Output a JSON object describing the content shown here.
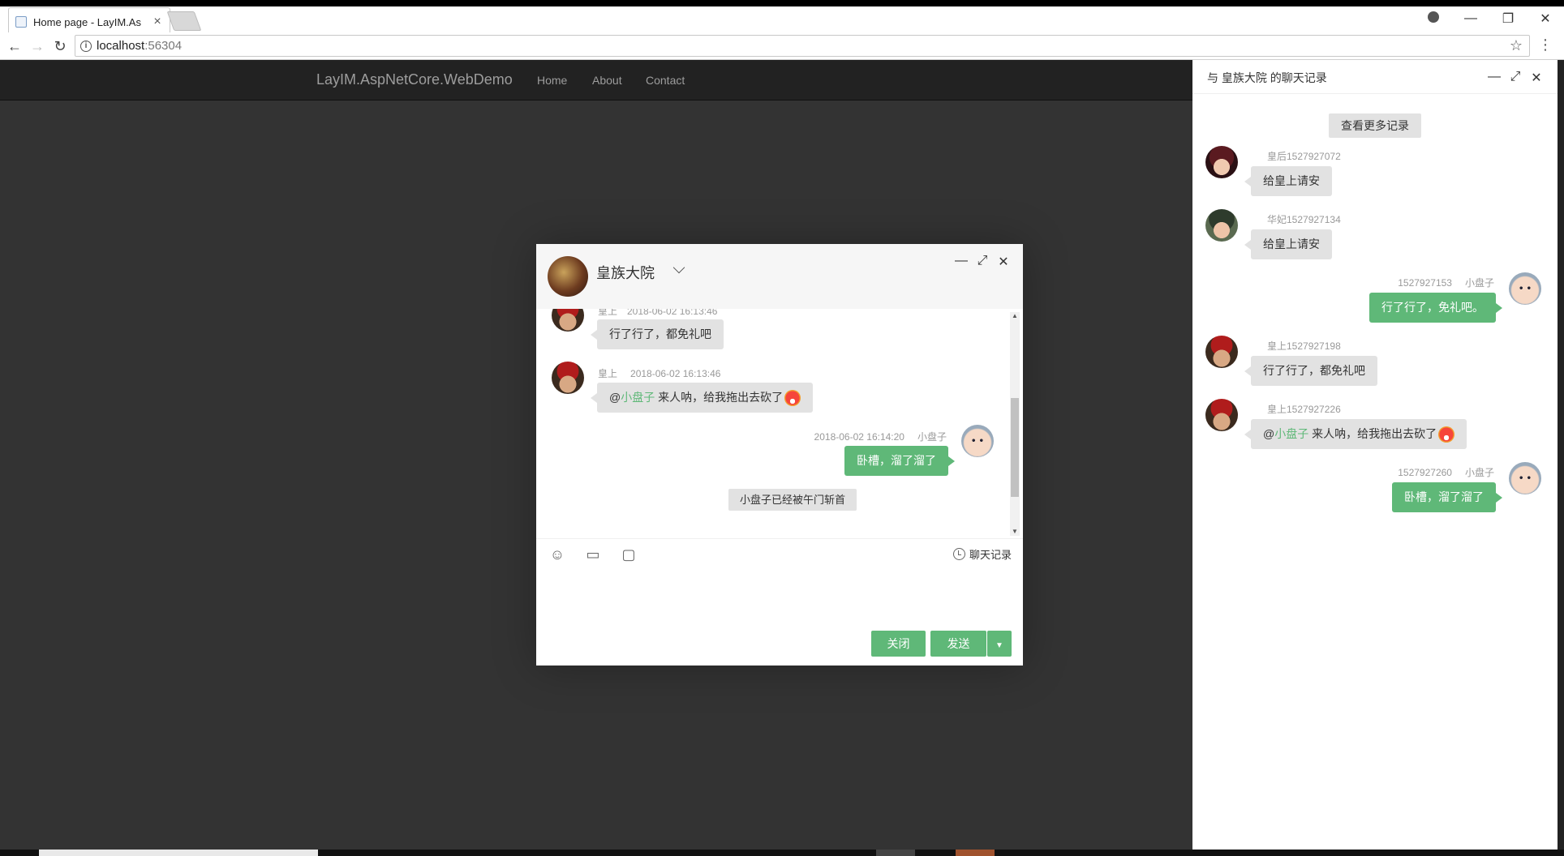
{
  "browser": {
    "tab_title": "Home page - LayIM.As",
    "url_host": "localhost",
    "url_port": ":56304"
  },
  "site": {
    "brand": "LayIM.AspNetCore.WebDemo",
    "nav": [
      "Home",
      "About",
      "Contact"
    ]
  },
  "chat": {
    "group_name": "皇族大院",
    "messages": [
      {
        "meta": "皇上　2018-06-02 16:13:46",
        "text": "行了行了，都免礼吧"
      },
      {
        "meta_name": "皇上",
        "meta_time": "2018-06-02 16:13:46",
        "at": "@",
        "at_name": "小盘子",
        "text": " 来人呐，给我拖出去砍了"
      },
      {
        "meta_time": "2018-06-02 16:14:20",
        "meta_name": "小盘子",
        "text": "卧槽，溜了溜了"
      }
    ],
    "system_message": "小盘子已经被午门斩首",
    "history_link": "聊天记录",
    "close_button": "关闭",
    "send_button": "发送"
  },
  "history": {
    "title": "与 皇族大院 的聊天记录",
    "more_button": "查看更多记录",
    "entries": [
      {
        "meta": "皇后1527927072",
        "text": "给皇上请安"
      },
      {
        "meta": "华妃1527927134",
        "text": "给皇上请安"
      },
      {
        "meta_time": "1527927153",
        "meta_name": "小盘子",
        "text": "行了行了，免礼吧。"
      },
      {
        "meta": "皇上1527927198",
        "text": "行了行了，都免礼吧"
      },
      {
        "meta": "皇上1527927226",
        "at": "@",
        "at_name": "小盘子",
        "text": " 来人呐，给我拖出去砍了"
      },
      {
        "meta_time": "1527927260",
        "meta_name": "小盘子",
        "text": "卧槽，溜了溜了"
      }
    ]
  },
  "colors": {
    "accent": "#5fb878",
    "page_bg": "#333333",
    "navbar_bg": "#222222"
  }
}
